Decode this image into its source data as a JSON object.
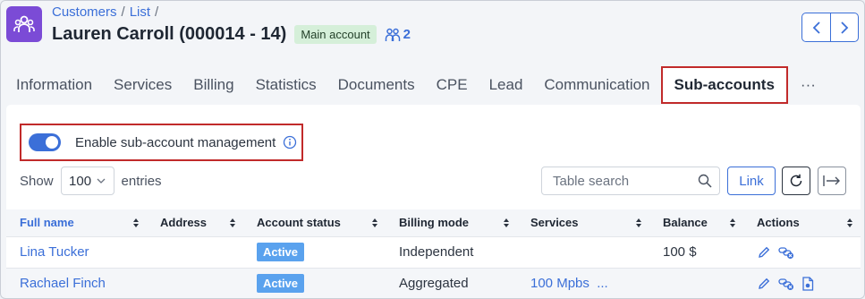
{
  "breadcrumb": {
    "items": [
      "Customers",
      "List"
    ],
    "separator": "/"
  },
  "header": {
    "title": "Lauren Carroll (000014 - 14)",
    "badge": "Main account",
    "sub_count": "2"
  },
  "tabs": [
    {
      "label": "Information"
    },
    {
      "label": "Services"
    },
    {
      "label": "Billing"
    },
    {
      "label": "Statistics"
    },
    {
      "label": "Documents"
    },
    {
      "label": "CPE"
    },
    {
      "label": "Lead"
    },
    {
      "label": "Communication"
    },
    {
      "label": "Sub-accounts",
      "active": true
    },
    {
      "label": "···"
    }
  ],
  "toggle": {
    "label": "Enable sub-account management",
    "enabled": true
  },
  "length": {
    "show_label": "Show",
    "value": "100",
    "entries_label": "entries"
  },
  "search": {
    "placeholder": "Table search"
  },
  "toolbar": {
    "link_label": "Link"
  },
  "table": {
    "columns": [
      "Full name",
      "Address",
      "Account status",
      "Billing mode",
      "Services",
      "Balance",
      "Actions"
    ],
    "rows": [
      {
        "full_name": "Lina Tucker",
        "address": "",
        "status": "Active",
        "billing_mode": "Independent",
        "services": "",
        "balance": "100 $"
      },
      {
        "full_name": "Rachael Finch",
        "address": "",
        "status": "Active",
        "billing_mode": "Aggregated",
        "services": "100 Mpbs  ...",
        "balance": ""
      }
    ]
  },
  "colors": {
    "accent": "#3b6fd8",
    "highlight": "#c12a2a",
    "app_icon": "#7b4bd6",
    "status": "#5aa2ee"
  }
}
